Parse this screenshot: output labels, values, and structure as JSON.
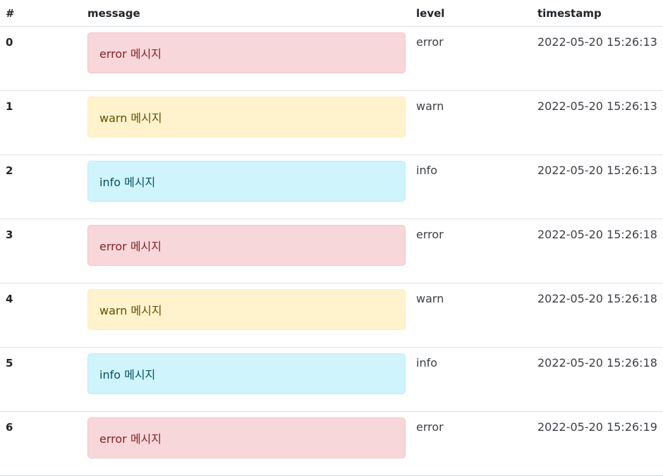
{
  "table": {
    "headers": {
      "index": "#",
      "message": "message",
      "level": "level",
      "timestamp": "timestamp"
    },
    "rows": [
      {
        "index": "0",
        "message": "error 메시지",
        "level": "error",
        "timestamp": "2022-05-20 15:26:13"
      },
      {
        "index": "1",
        "message": "warn 메시지",
        "level": "warn",
        "timestamp": "2022-05-20 15:26:13"
      },
      {
        "index": "2",
        "message": "info 메시지",
        "level": "info",
        "timestamp": "2022-05-20 15:26:13"
      },
      {
        "index": "3",
        "message": "error 메시지",
        "level": "error",
        "timestamp": "2022-05-20 15:26:18"
      },
      {
        "index": "4",
        "message": "warn 메시지",
        "level": "warn",
        "timestamp": "2022-05-20 15:26:18"
      },
      {
        "index": "5",
        "message": "info 메시지",
        "level": "info",
        "timestamp": "2022-05-20 15:26:18"
      },
      {
        "index": "6",
        "message": "error 메시지",
        "level": "error",
        "timestamp": "2022-05-20 15:26:19"
      }
    ]
  },
  "colors": {
    "error_bg": "#f8d7da",
    "error_text": "#842029",
    "warn_bg": "#fff3cd",
    "warn_text": "#664d03",
    "info_bg": "#cff4fc",
    "info_text": "#055160",
    "border": "#dee2e6"
  }
}
